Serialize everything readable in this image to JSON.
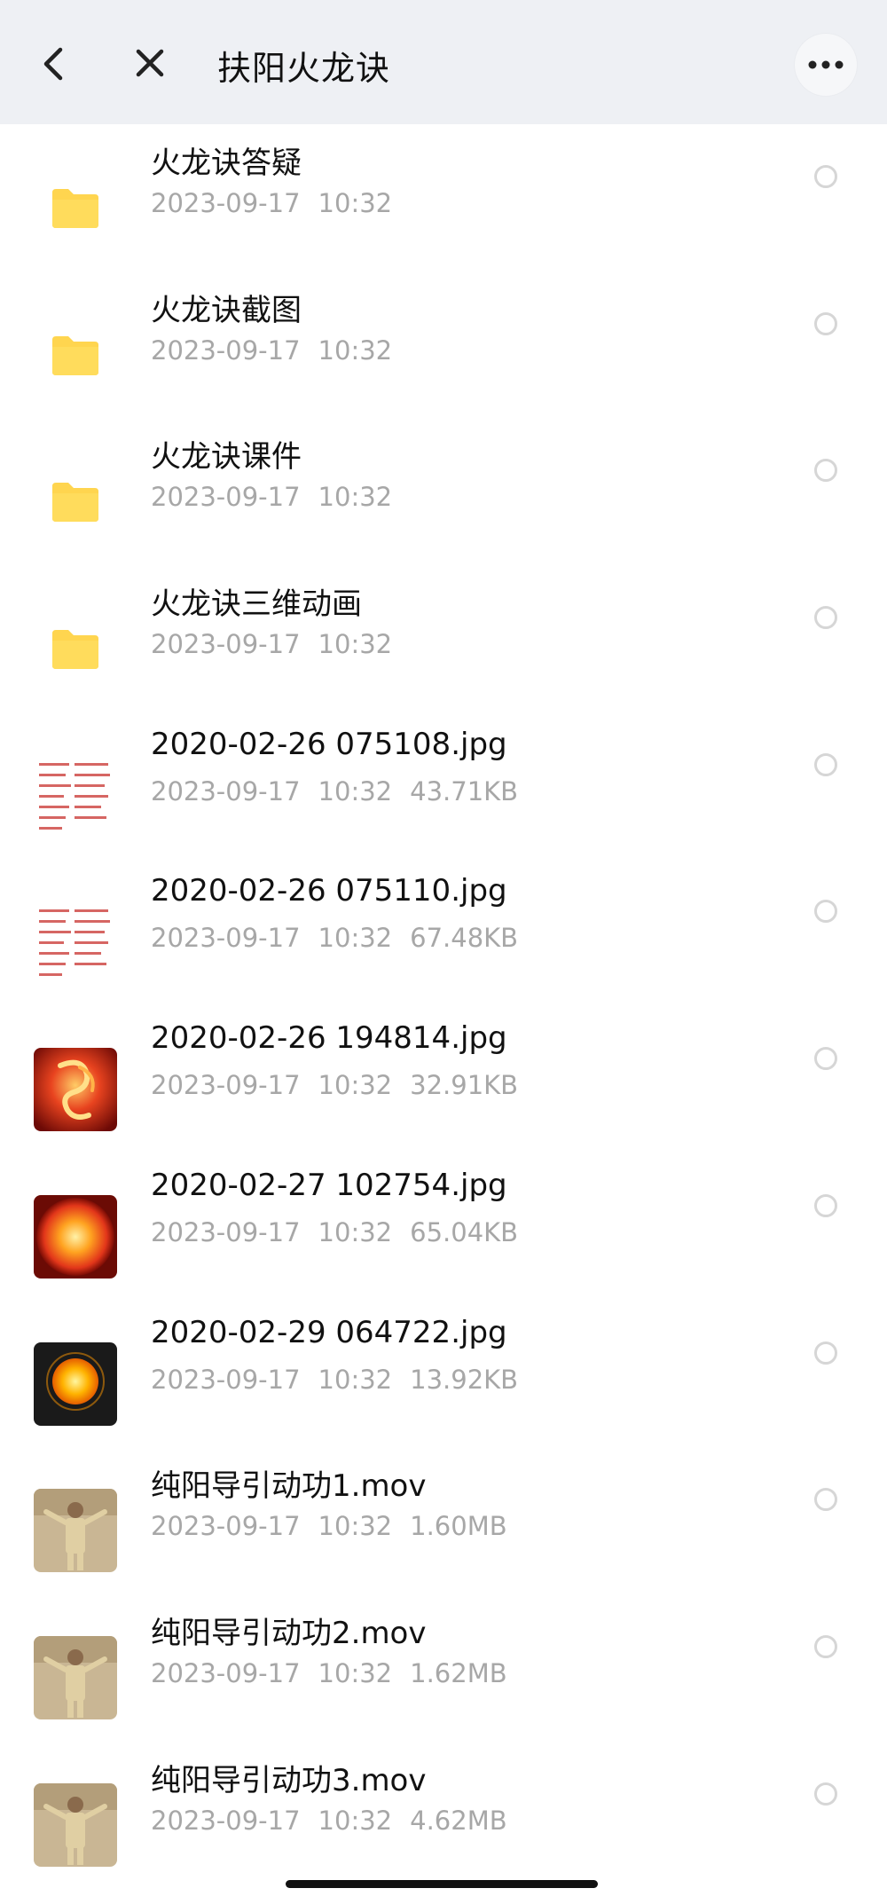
{
  "header": {
    "title": "扶阳火龙诀"
  },
  "icons": {
    "back": "chevron-left-icon",
    "close": "close-icon",
    "more": "more-horizontal-icon",
    "folder": "folder-icon"
  },
  "colors": {
    "folder": "#ffd54f",
    "header_bg": "#eef0f4",
    "meta_text": "#a7a7a7"
  },
  "files": [
    {
      "name": "火龙诀答疑",
      "date": "2023-09-17",
      "time": "10:32",
      "size": "",
      "kind": "folder"
    },
    {
      "name": "火龙诀截图",
      "date": "2023-09-17",
      "time": "10:32",
      "size": "",
      "kind": "folder"
    },
    {
      "name": "火龙诀课件",
      "date": "2023-09-17",
      "time": "10:32",
      "size": "",
      "kind": "folder"
    },
    {
      "name": "火龙诀三维动画",
      "date": "2023-09-17",
      "time": "10:32",
      "size": "",
      "kind": "folder"
    },
    {
      "name": "2020-02-26 075108.jpg",
      "date": "2023-09-17",
      "time": "10:32",
      "size": "43.71KB",
      "kind": "text-image"
    },
    {
      "name": "2020-02-26 075110.jpg",
      "date": "2023-09-17",
      "time": "10:32",
      "size": "67.48KB",
      "kind": "text-image"
    },
    {
      "name": "2020-02-26 194814.jpg",
      "date": "2023-09-17",
      "time": "10:32",
      "size": "32.91KB",
      "kind": "dragon-image"
    },
    {
      "name": "2020-02-27 102754.jpg",
      "date": "2023-09-17",
      "time": "10:32",
      "size": "65.04KB",
      "kind": "fire-orb-image"
    },
    {
      "name": "2020-02-29 064722.jpg",
      "date": "2023-09-17",
      "time": "10:32",
      "size": "13.92KB",
      "kind": "sun-image"
    },
    {
      "name": "纯阳导引动功1.mov",
      "date": "2023-09-17",
      "time": "10:32",
      "size": "1.60MB",
      "kind": "video"
    },
    {
      "name": "纯阳导引动功2.mov",
      "date": "2023-09-17",
      "time": "10:32",
      "size": "1.62MB",
      "kind": "video"
    },
    {
      "name": "纯阳导引动功3.mov",
      "date": "2023-09-17",
      "time": "10:32",
      "size": "4.62MB",
      "kind": "video"
    }
  ]
}
